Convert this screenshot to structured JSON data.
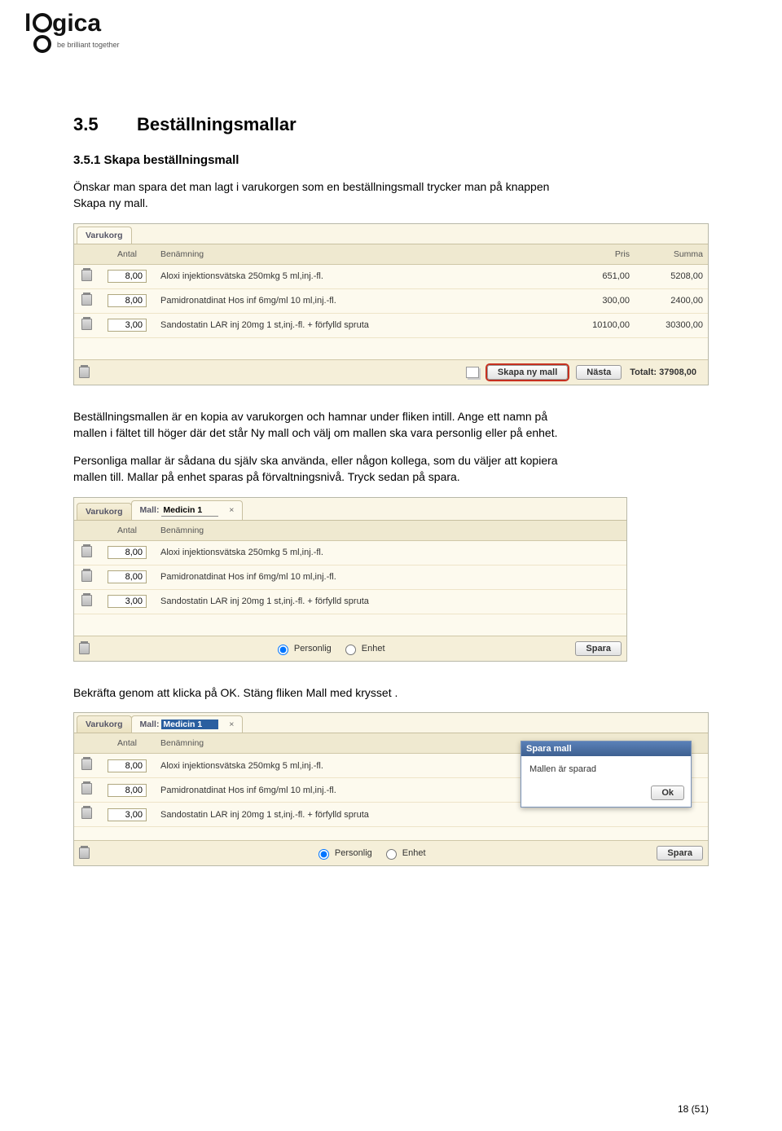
{
  "logo": {
    "name": "logica",
    "tagline": "be brilliant together"
  },
  "section": {
    "num": "3.5",
    "title": "Beställningsmallar"
  },
  "subsection": {
    "num": "3.5.1",
    "title": "Skapa beställningsmall"
  },
  "para1": "Önskar man spara det man lagt i varukorgen som en beställningsmall trycker man på knappen Skapa ny mall.",
  "para2": "Beställningsmallen är en kopia av varukorgen och hamnar under fliken intill. Ange ett namn på mallen i fältet till höger där det står Ny mall och välj om mallen ska vara personlig eller på enhet.",
  "para3": "Personliga mallar är sådana du själv ska använda, eller någon kollega, som du väljer att kopiera mallen till. Mallar på enhet sparas på förvaltningsnivå. Tryck sedan på spara.",
  "para4": "Bekräfta genom att klicka på OK. Stäng fliken Mall med krysset .",
  "shot1": {
    "tab": "Varukorg",
    "headers": {
      "antal": "Antal",
      "ben": "Benämning",
      "pris": "Pris",
      "summa": "Summa"
    },
    "rows": [
      {
        "antal": "8,00",
        "ben": "Aloxi injektionsvätska 250mkg 5 ml,inj.-fl.",
        "pris": "651,00",
        "summa": "5208,00"
      },
      {
        "antal": "8,00",
        "ben": "Pamidronatdinat Hos inf 6mg/ml 10 ml,inj.-fl.",
        "pris": "300,00",
        "summa": "2400,00"
      },
      {
        "antal": "3,00",
        "ben": "Sandostatin LAR inj 20mg 1 st,inj.-fl. + förfylld spruta",
        "pris": "10100,00",
        "summa": "30300,00"
      }
    ],
    "btn_new": "Skapa ny mall",
    "btn_next": "Nästa",
    "total_label": "Totalt:",
    "total_value": "37908,00"
  },
  "shot2": {
    "tab1": "Varukorg",
    "tab2_prefix": "Mall:",
    "tab2_value": "Medicin 1",
    "headers": {
      "antal": "Antal",
      "ben": "Benämning"
    },
    "rows": [
      {
        "antal": "8,00",
        "ben": "Aloxi injektionsvätska 250mkg 5 ml,inj.-fl."
      },
      {
        "antal": "8,00",
        "ben": "Pamidronatdinat Hos inf 6mg/ml 10 ml,inj.-fl."
      },
      {
        "antal": "3,00",
        "ben": "Sandostatin LAR inj 20mg 1 st,inj.-fl. + förfylld spruta"
      }
    ],
    "radio_personlig": "Personlig",
    "radio_enhet": "Enhet",
    "btn_save": "Spara"
  },
  "shot3": {
    "tab1": "Varukorg",
    "tab2_prefix": "Mall:",
    "tab2_value": "Medicin 1",
    "headers": {
      "antal": "Antal",
      "ben": "Benämning"
    },
    "rows": [
      {
        "antal": "8,00",
        "ben": "Aloxi injektionsvätska 250mkg 5 ml,inj.-fl."
      },
      {
        "antal": "8,00",
        "ben": "Pamidronatdinat Hos inf 6mg/ml 10 ml,inj.-fl."
      },
      {
        "antal": "3,00",
        "ben": "Sandostatin LAR inj 20mg 1 st,inj.-fl. + förfylld spruta"
      }
    ],
    "radio_personlig": "Personlig",
    "radio_enhet": "Enhet",
    "btn_save": "Spara",
    "popup": {
      "title": "Spara mall",
      "msg": "Mallen är sparad",
      "ok": "Ok"
    }
  },
  "footer": {
    "page": "18 (51)"
  }
}
